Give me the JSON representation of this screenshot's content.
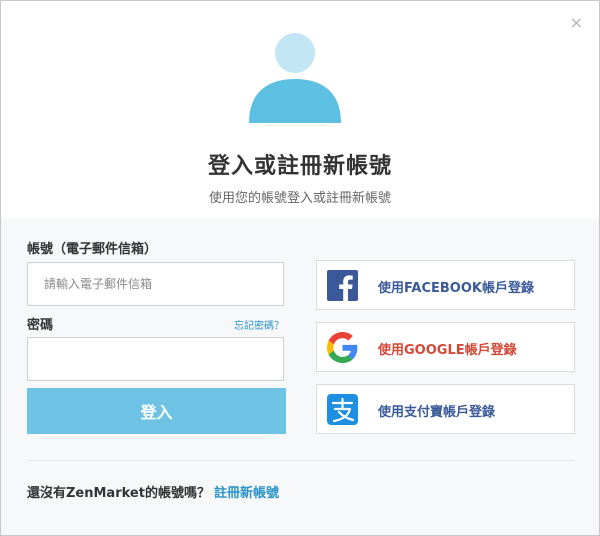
{
  "modal": {
    "close_label": "×"
  },
  "header": {
    "title": "登入或註冊新帳號",
    "subtitle": "使用您的帳號登入或註冊新帳號"
  },
  "form": {
    "email_label": "帳號（電子郵件信箱）",
    "email_placeholder": "請輸入電子郵件信箱",
    "email_value": "",
    "password_label": "密碼",
    "password_value": "",
    "forgot_label": "忘記密碼？",
    "login_label": "登入"
  },
  "social": {
    "facebook_label": "使用FACEBOOK帳戶登錄",
    "google_label": "使用GOOGLE帳戶登錄",
    "alipay_label": "使用支付寶帳戶登錄"
  },
  "footer": {
    "prompt": "還沒有ZenMarket的帳號嗎？",
    "register_label": "註冊新帳號"
  },
  "colors": {
    "accent": "#6ec3e4",
    "link": "#2a93c9",
    "facebook": "#3b5998",
    "google_text": "#d34836",
    "alipay": "#1e8fe1",
    "social_text": "#3a5a98"
  }
}
